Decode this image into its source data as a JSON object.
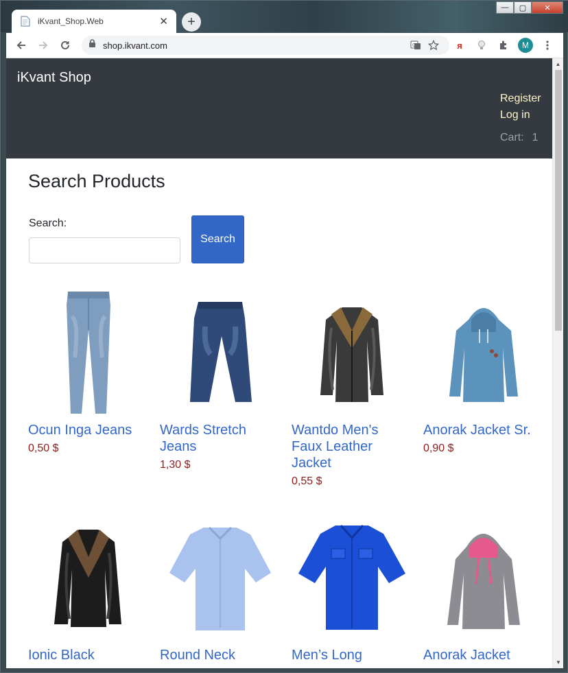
{
  "browser": {
    "tab_title": "iKvant_Shop.Web",
    "tab_close": "✕",
    "new_tab": "+",
    "url": "shop.ikvant.com",
    "profile_initial": "M",
    "ext_yandex": "я"
  },
  "window": {
    "minimize": "—",
    "maximize": "▢",
    "close": "✕"
  },
  "site": {
    "brand": "iKvant Shop",
    "register": "Register",
    "login": "Log in",
    "cart_label": "Cart:",
    "cart_count": "1"
  },
  "search": {
    "title": "Search Products",
    "label": "Search:",
    "value": "",
    "button": "Search"
  },
  "products": [
    {
      "name": "Ocun Inga Jeans",
      "price": "0,50 $",
      "image": "light-blue-jeans"
    },
    {
      "name": "Wards Stretch Jeans",
      "price": "1,30 $",
      "image": "dark-blue-jeans"
    },
    {
      "name": "Wantdo Men's Faux Leather Jacket",
      "price": "0,55 $",
      "image": "leather-jacket-fur-collar"
    },
    {
      "name": "Anorak Jacket Sr.",
      "price": "0,90 $",
      "image": "blue-hoodie"
    },
    {
      "name": "Ionic Black",
      "price": "",
      "image": "black-leather-jacket"
    },
    {
      "name": "Round Neck",
      "price": "",
      "image": "light-blue-shirt"
    },
    {
      "name": "Men’s Long",
      "price": "",
      "image": "royal-blue-shirt"
    },
    {
      "name": "Anorak Jacket",
      "price": "",
      "image": "grey-pink-hoodie"
    }
  ],
  "colors": {
    "navbar": "#343a40",
    "link": "#3267c8",
    "price": "#8a1c1c",
    "button": "#3267c8"
  }
}
